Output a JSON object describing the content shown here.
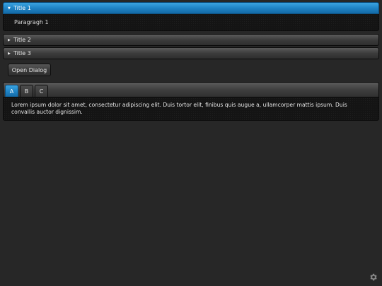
{
  "accordion": {
    "panels": [
      {
        "title": "Title 1",
        "content": "Paragragh 1",
        "expanded": true
      },
      {
        "title": "Title 2",
        "expanded": false
      },
      {
        "title": "Title 3",
        "expanded": false
      }
    ]
  },
  "dialog_button": {
    "label": "Open Dialog"
  },
  "tabs": {
    "items": [
      {
        "label": "A",
        "active": true
      },
      {
        "label": "B",
        "active": false
      },
      {
        "label": "C",
        "active": false
      }
    ],
    "content": "Lorem ipsum dolor sit amet, consectetur adipiscing elit. Duis tortor elit, finibus quis augue a, ullamcorper mattis ipsum. Duis convallis auctor dignissim."
  },
  "icons": {
    "expanded": "triangle-down-icon",
    "collapsed": "triangle-right-icon",
    "settings": "gear-icon"
  },
  "colors": {
    "accent": "#1f83c5",
    "background": "#272727",
    "panel": "#141414"
  }
}
